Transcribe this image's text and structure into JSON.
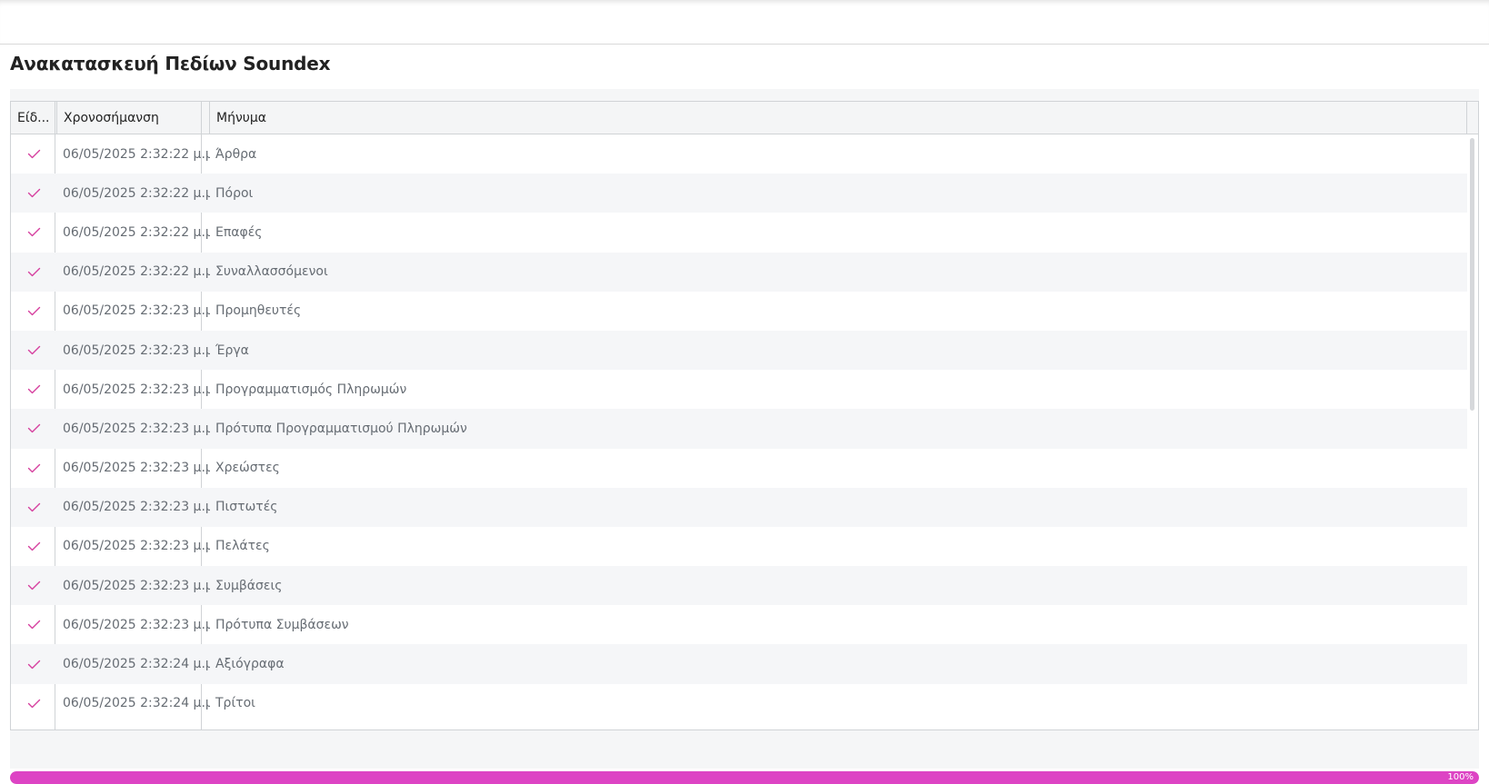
{
  "page_title": "Ανακατασκευή Πεδίων Soundex",
  "grid": {
    "columns": {
      "type": "Είδ...",
      "timestamp": "Χρονοσήμανση",
      "message": "Μήνυμα"
    },
    "rows": [
      {
        "status": "check-icon",
        "timestamp": "06/05/2025 2:32:22 μ.μ.",
        "message": "Άρθρα"
      },
      {
        "status": "check-icon",
        "timestamp": "06/05/2025 2:32:22 μ.μ.",
        "message": "Πόροι"
      },
      {
        "status": "check-icon",
        "timestamp": "06/05/2025 2:32:22 μ.μ.",
        "message": "Επαφές"
      },
      {
        "status": "check-icon",
        "timestamp": "06/05/2025 2:32:22 μ.μ.",
        "message": "Συναλλασσόμενοι"
      },
      {
        "status": "check-icon",
        "timestamp": "06/05/2025 2:32:23 μ.μ.",
        "message": "Προμηθευτές"
      },
      {
        "status": "check-icon",
        "timestamp": "06/05/2025 2:32:23 μ.μ.",
        "message": "Έργα"
      },
      {
        "status": "check-icon",
        "timestamp": "06/05/2025 2:32:23 μ.μ.",
        "message": "Προγραμματισμός Πληρωμών"
      },
      {
        "status": "check-icon",
        "timestamp": "06/05/2025 2:32:23 μ.μ.",
        "message": "Πρότυπα Προγραμματισμού Πληρωμών"
      },
      {
        "status": "check-icon",
        "timestamp": "06/05/2025 2:32:23 μ.μ.",
        "message": "Χρεώστες"
      },
      {
        "status": "check-icon",
        "timestamp": "06/05/2025 2:32:23 μ.μ.",
        "message": "Πιστωτές"
      },
      {
        "status": "check-icon",
        "timestamp": "06/05/2025 2:32:23 μ.μ.",
        "message": "Πελάτες"
      },
      {
        "status": "check-icon",
        "timestamp": "06/05/2025 2:32:23 μ.μ.",
        "message": "Συμβάσεις"
      },
      {
        "status": "check-icon",
        "timestamp": "06/05/2025 2:32:23 μ.μ.",
        "message": "Πρότυπα Συμβάσεων"
      },
      {
        "status": "check-icon",
        "timestamp": "06/05/2025 2:32:24 μ.μ.",
        "message": "Αξιόγραφα"
      },
      {
        "status": "check-icon",
        "timestamp": "06/05/2025 2:32:24 μ.μ.",
        "message": "Τρίτοι"
      }
    ]
  },
  "progress": {
    "label": "100%",
    "value": 1.0
  },
  "colors": {
    "accent": "#dd44c4",
    "check": "#d6409f"
  }
}
